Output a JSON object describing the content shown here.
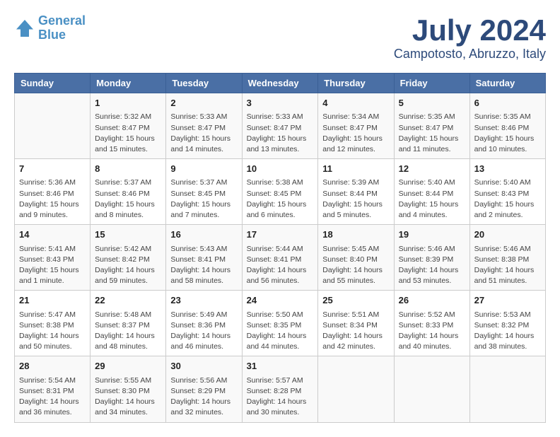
{
  "header": {
    "logo_line1": "General",
    "logo_line2": "Blue",
    "month": "July 2024",
    "location": "Campotosto, Abruzzo, Italy"
  },
  "weekdays": [
    "Sunday",
    "Monday",
    "Tuesday",
    "Wednesday",
    "Thursday",
    "Friday",
    "Saturday"
  ],
  "weeks": [
    [
      {
        "day": "",
        "sunrise": "",
        "sunset": "",
        "daylight": ""
      },
      {
        "day": "1",
        "sunrise": "Sunrise: 5:32 AM",
        "sunset": "Sunset: 8:47 PM",
        "daylight": "Daylight: 15 hours and 15 minutes."
      },
      {
        "day": "2",
        "sunrise": "Sunrise: 5:33 AM",
        "sunset": "Sunset: 8:47 PM",
        "daylight": "Daylight: 15 hours and 14 minutes."
      },
      {
        "day": "3",
        "sunrise": "Sunrise: 5:33 AM",
        "sunset": "Sunset: 8:47 PM",
        "daylight": "Daylight: 15 hours and 13 minutes."
      },
      {
        "day": "4",
        "sunrise": "Sunrise: 5:34 AM",
        "sunset": "Sunset: 8:47 PM",
        "daylight": "Daylight: 15 hours and 12 minutes."
      },
      {
        "day": "5",
        "sunrise": "Sunrise: 5:35 AM",
        "sunset": "Sunset: 8:47 PM",
        "daylight": "Daylight: 15 hours and 11 minutes."
      },
      {
        "day": "6",
        "sunrise": "Sunrise: 5:35 AM",
        "sunset": "Sunset: 8:46 PM",
        "daylight": "Daylight: 15 hours and 10 minutes."
      }
    ],
    [
      {
        "day": "7",
        "sunrise": "Sunrise: 5:36 AM",
        "sunset": "Sunset: 8:46 PM",
        "daylight": "Daylight: 15 hours and 9 minutes."
      },
      {
        "day": "8",
        "sunrise": "Sunrise: 5:37 AM",
        "sunset": "Sunset: 8:46 PM",
        "daylight": "Daylight: 15 hours and 8 minutes."
      },
      {
        "day": "9",
        "sunrise": "Sunrise: 5:37 AM",
        "sunset": "Sunset: 8:45 PM",
        "daylight": "Daylight: 15 hours and 7 minutes."
      },
      {
        "day": "10",
        "sunrise": "Sunrise: 5:38 AM",
        "sunset": "Sunset: 8:45 PM",
        "daylight": "Daylight: 15 hours and 6 minutes."
      },
      {
        "day": "11",
        "sunrise": "Sunrise: 5:39 AM",
        "sunset": "Sunset: 8:44 PM",
        "daylight": "Daylight: 15 hours and 5 minutes."
      },
      {
        "day": "12",
        "sunrise": "Sunrise: 5:40 AM",
        "sunset": "Sunset: 8:44 PM",
        "daylight": "Daylight: 15 hours and 4 minutes."
      },
      {
        "day": "13",
        "sunrise": "Sunrise: 5:40 AM",
        "sunset": "Sunset: 8:43 PM",
        "daylight": "Daylight: 15 hours and 2 minutes."
      }
    ],
    [
      {
        "day": "14",
        "sunrise": "Sunrise: 5:41 AM",
        "sunset": "Sunset: 8:43 PM",
        "daylight": "Daylight: 15 hours and 1 minute."
      },
      {
        "day": "15",
        "sunrise": "Sunrise: 5:42 AM",
        "sunset": "Sunset: 8:42 PM",
        "daylight": "Daylight: 14 hours and 59 minutes."
      },
      {
        "day": "16",
        "sunrise": "Sunrise: 5:43 AM",
        "sunset": "Sunset: 8:41 PM",
        "daylight": "Daylight: 14 hours and 58 minutes."
      },
      {
        "day": "17",
        "sunrise": "Sunrise: 5:44 AM",
        "sunset": "Sunset: 8:41 PM",
        "daylight": "Daylight: 14 hours and 56 minutes."
      },
      {
        "day": "18",
        "sunrise": "Sunrise: 5:45 AM",
        "sunset": "Sunset: 8:40 PM",
        "daylight": "Daylight: 14 hours and 55 minutes."
      },
      {
        "day": "19",
        "sunrise": "Sunrise: 5:46 AM",
        "sunset": "Sunset: 8:39 PM",
        "daylight": "Daylight: 14 hours and 53 minutes."
      },
      {
        "day": "20",
        "sunrise": "Sunrise: 5:46 AM",
        "sunset": "Sunset: 8:38 PM",
        "daylight": "Daylight: 14 hours and 51 minutes."
      }
    ],
    [
      {
        "day": "21",
        "sunrise": "Sunrise: 5:47 AM",
        "sunset": "Sunset: 8:38 PM",
        "daylight": "Daylight: 14 hours and 50 minutes."
      },
      {
        "day": "22",
        "sunrise": "Sunrise: 5:48 AM",
        "sunset": "Sunset: 8:37 PM",
        "daylight": "Daylight: 14 hours and 48 minutes."
      },
      {
        "day": "23",
        "sunrise": "Sunrise: 5:49 AM",
        "sunset": "Sunset: 8:36 PM",
        "daylight": "Daylight: 14 hours and 46 minutes."
      },
      {
        "day": "24",
        "sunrise": "Sunrise: 5:50 AM",
        "sunset": "Sunset: 8:35 PM",
        "daylight": "Daylight: 14 hours and 44 minutes."
      },
      {
        "day": "25",
        "sunrise": "Sunrise: 5:51 AM",
        "sunset": "Sunset: 8:34 PM",
        "daylight": "Daylight: 14 hours and 42 minutes."
      },
      {
        "day": "26",
        "sunrise": "Sunrise: 5:52 AM",
        "sunset": "Sunset: 8:33 PM",
        "daylight": "Daylight: 14 hours and 40 minutes."
      },
      {
        "day": "27",
        "sunrise": "Sunrise: 5:53 AM",
        "sunset": "Sunset: 8:32 PM",
        "daylight": "Daylight: 14 hours and 38 minutes."
      }
    ],
    [
      {
        "day": "28",
        "sunrise": "Sunrise: 5:54 AM",
        "sunset": "Sunset: 8:31 PM",
        "daylight": "Daylight: 14 hours and 36 minutes."
      },
      {
        "day": "29",
        "sunrise": "Sunrise: 5:55 AM",
        "sunset": "Sunset: 8:30 PM",
        "daylight": "Daylight: 14 hours and 34 minutes."
      },
      {
        "day": "30",
        "sunrise": "Sunrise: 5:56 AM",
        "sunset": "Sunset: 8:29 PM",
        "daylight": "Daylight: 14 hours and 32 minutes."
      },
      {
        "day": "31",
        "sunrise": "Sunrise: 5:57 AM",
        "sunset": "Sunset: 8:28 PM",
        "daylight": "Daylight: 14 hours and 30 minutes."
      },
      {
        "day": "",
        "sunrise": "",
        "sunset": "",
        "daylight": ""
      },
      {
        "day": "",
        "sunrise": "",
        "sunset": "",
        "daylight": ""
      },
      {
        "day": "",
        "sunrise": "",
        "sunset": "",
        "daylight": ""
      }
    ]
  ]
}
